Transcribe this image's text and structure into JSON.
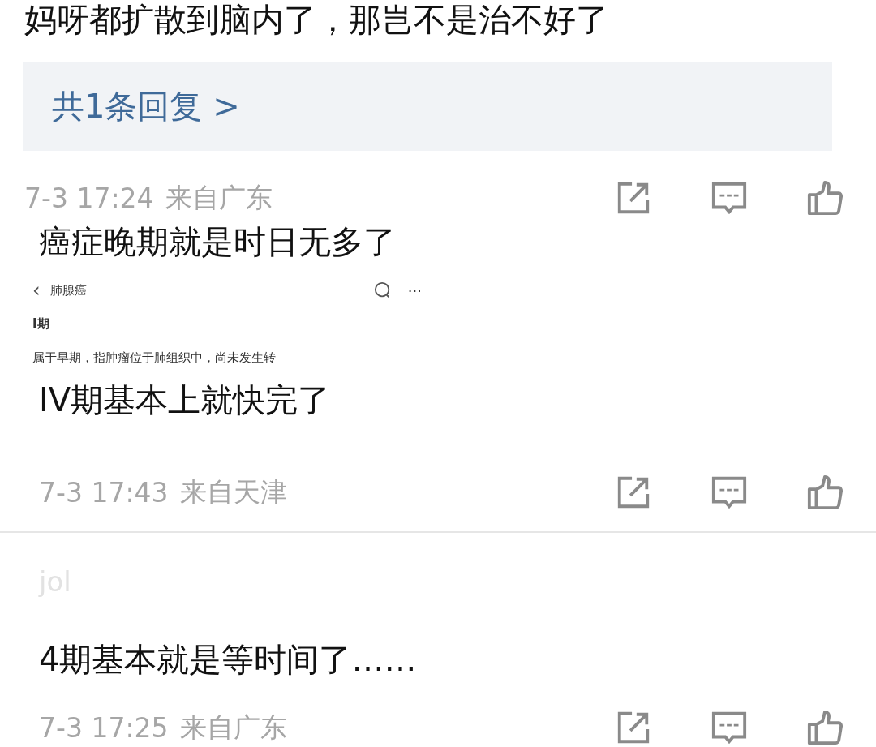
{
  "comments": [
    {
      "blocks": [
        {
          "kind": "text",
          "text": "妈呀都扩散到脑内了，那岂不是治不好了"
        },
        {
          "kind": "replies",
          "text": "共1条回复 >"
        }
      ],
      "time": "7-3 17:24",
      "location": "来自广东"
    },
    {
      "blocks": [
        {
          "kind": "text",
          "text": "癌症晚期就是时日无多了"
        },
        {
          "kind": "screenshot",
          "back": "‹",
          "title": "肺腺癌",
          "more": "···",
          "heading": "I期",
          "body": "属于早期，指肿瘤位于肺组织中，尚未发生转"
        },
        {
          "kind": "text",
          "text": "IV期基本上就快完了"
        }
      ],
      "time": "7-3 17:43",
      "location": "来自天津"
    },
    {
      "username": "jol",
      "blocks": [
        {
          "kind": "text",
          "text": "4期基本就是等时间了……"
        }
      ],
      "time": "7-3 17:25",
      "location": "来自广东"
    }
  ]
}
